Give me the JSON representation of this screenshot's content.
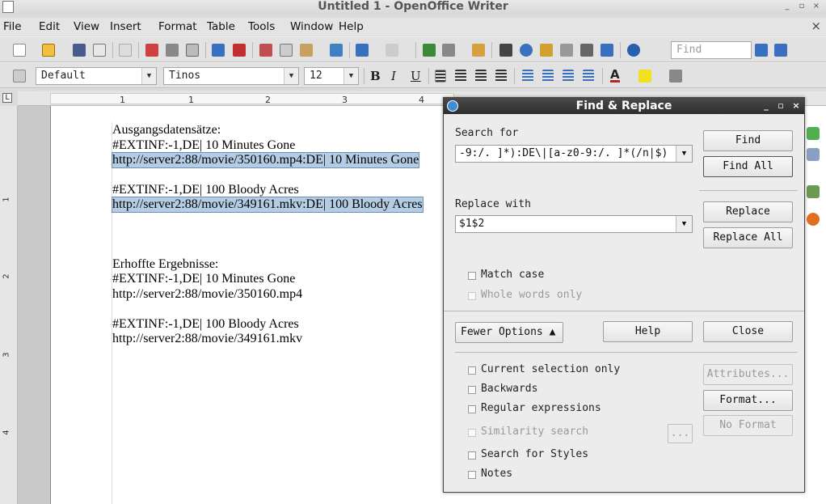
{
  "window": {
    "title": "Untitled 1 - OpenOffice Writer",
    "controls": [
      "_",
      "▫",
      "×"
    ]
  },
  "menu": {
    "items": [
      "File",
      "Edit",
      "View",
      "Insert",
      "Format",
      "Table",
      "Tools",
      "Window",
      "Help"
    ],
    "close_doc": "×"
  },
  "toolbar": {
    "find_placeholder": "Find",
    "paragraph_style": "Default",
    "font_name": "Tinos",
    "font_size": "12"
  },
  "ruler": {
    "h_numbers": [
      "1",
      "1",
      "2",
      "3",
      "4"
    ],
    "v_numbers": [
      "1",
      "2",
      "3",
      "4"
    ]
  },
  "document": {
    "lines": [
      "Ausgangsdatensätze:",
      "#EXTINF:-1,DE| 10 Minutes Gone",
      "http://server2:88/movie/350160.mp4:DE| 10 Minutes Gone",
      "#EXTINF:-1,DE| 100 Bloody Acres",
      "http://server2:88/movie/349161.mkv:DE| 100 Bloody Acres",
      "Erhoffte Ergebnisse:",
      "#EXTINF:-1,DE| 10 Minutes Gone",
      "http://server2:88/movie/350160.mp4",
      "#EXTINF:-1,DE| 100 Bloody Acres",
      "http://server2:88/movie/349161.mkv"
    ]
  },
  "dialog": {
    "title": "Find & Replace",
    "search_label": "Search for",
    "search_value": "-9:/. ]*):DE\\|[a-z0-9:/. ]*(/n|$)",
    "replace_label": "Replace with",
    "replace_value": "$1$2",
    "find_button": "Find",
    "find_all_button": "Find All",
    "replace_button": "Replace",
    "replace_all_button": "Replace All",
    "match_case": "Match case",
    "whole_words": "Whole words only",
    "fewer_options": "Fewer Options",
    "help_button": "Help",
    "close_button": "Close",
    "current_selection": "Current selection only",
    "backwards": "Backwards",
    "regex": "Regular expressions",
    "similarity": "Similarity search",
    "similarity_btn": "...",
    "search_styles": "Search for Styles",
    "notes": "Notes",
    "attributes_button": "Attributes...",
    "format_button": "Format...",
    "no_format_button": "No Format"
  }
}
